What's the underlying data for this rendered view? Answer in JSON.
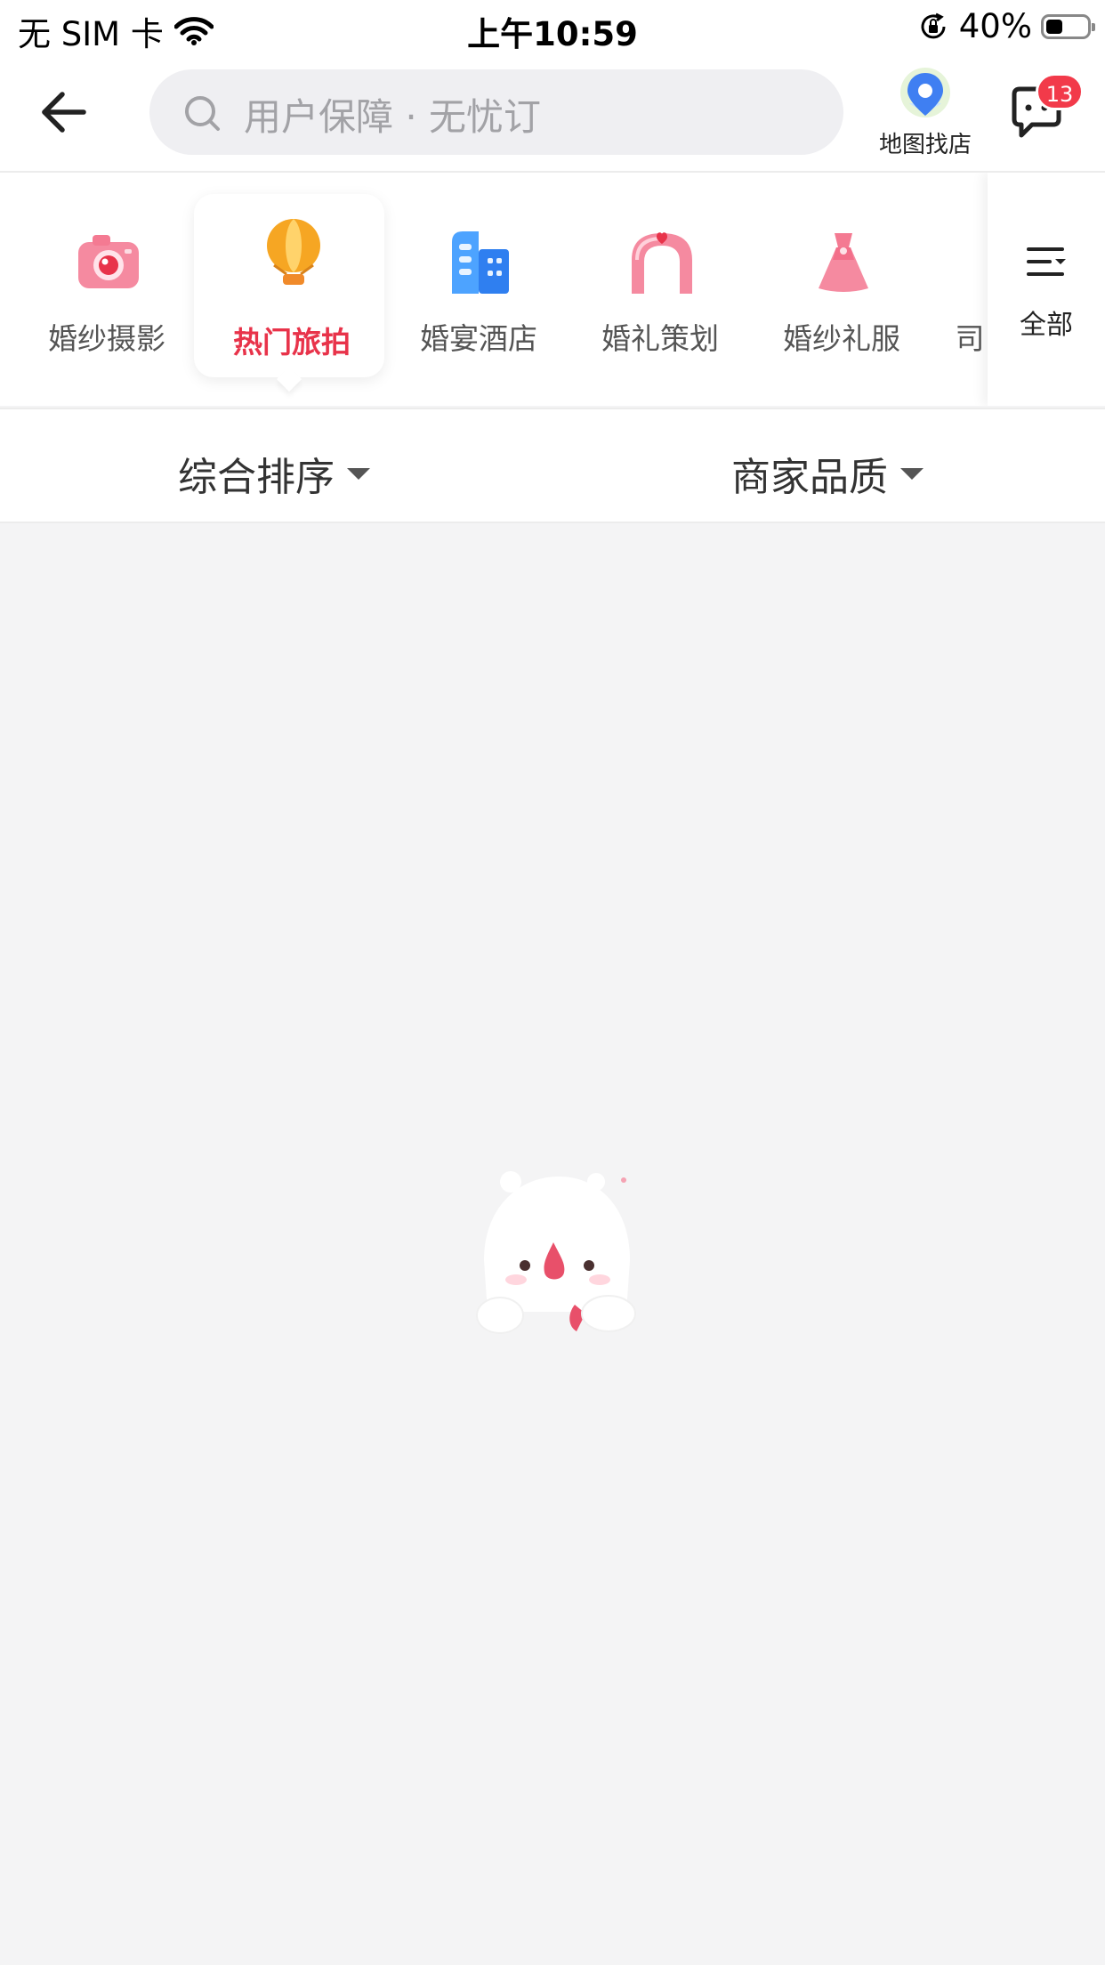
{
  "status_bar": {
    "carrier": "无 SIM 卡",
    "time": "上午10:59",
    "battery": "40%",
    "battery_level": 0.4
  },
  "header": {
    "search_placeholder": "用户保障 · 无忧订",
    "map_label": "地图找店",
    "message_badge": "13"
  },
  "categories": [
    {
      "label": "婚纱摄影",
      "icon": "camera-icon",
      "active": false
    },
    {
      "label": "热门旅拍",
      "icon": "hot-air-balloon-icon",
      "active": true
    },
    {
      "label": "婚宴酒店",
      "icon": "hotel-building-icon",
      "active": false
    },
    {
      "label": "婚礼策划",
      "icon": "wedding-arch-icon",
      "active": false
    },
    {
      "label": "婚纱礼服",
      "icon": "dress-icon",
      "active": false
    },
    {
      "label": "司",
      "icon": "",
      "active": false
    }
  ],
  "all_button": {
    "label": "全部",
    "icon": "menu-filter-icon"
  },
  "filters": [
    {
      "label": "综合排序"
    },
    {
      "label": "商家品质"
    }
  ],
  "colors": {
    "accent": "#e8334a",
    "badge": "#f23a4a",
    "background": "#f4f4f5"
  }
}
